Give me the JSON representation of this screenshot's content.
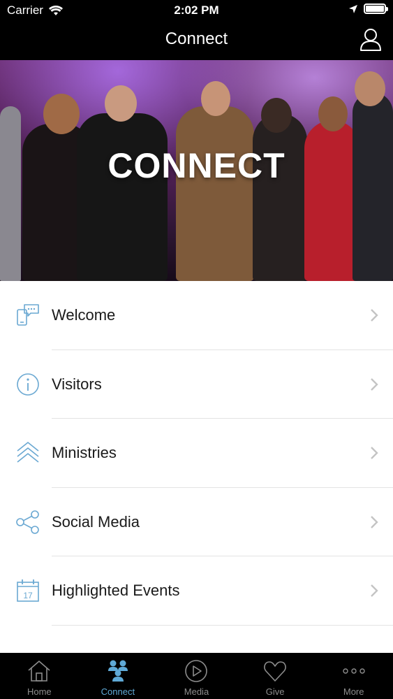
{
  "status_bar": {
    "carrier": "Carrier",
    "time": "2:02 PM"
  },
  "nav": {
    "title": "Connect"
  },
  "hero": {
    "title": "CONNECT"
  },
  "menu": {
    "items": [
      {
        "label": "Welcome",
        "icon": "phone-chat-icon"
      },
      {
        "label": "Visitors",
        "icon": "info-icon"
      },
      {
        "label": "Ministries",
        "icon": "chevrons-up-icon"
      },
      {
        "label": "Social Media",
        "icon": "share-icon"
      },
      {
        "label": "Highlighted Events",
        "icon": "calendar-icon",
        "calendar_day": "17"
      }
    ]
  },
  "tabs": [
    {
      "label": "Home",
      "icon": "home-icon",
      "active": false
    },
    {
      "label": "Connect",
      "icon": "people-icon",
      "active": true
    },
    {
      "label": "Media",
      "icon": "play-icon",
      "active": false
    },
    {
      "label": "Give",
      "icon": "heart-icon",
      "active": false
    },
    {
      "label": "More",
      "icon": "more-dots-icon",
      "active": false
    }
  ],
  "colors": {
    "accent": "#5fa9d6",
    "icon_blue": "#6aa8d2",
    "tab_inactive": "#8d8d8d",
    "bar": "#000000"
  }
}
